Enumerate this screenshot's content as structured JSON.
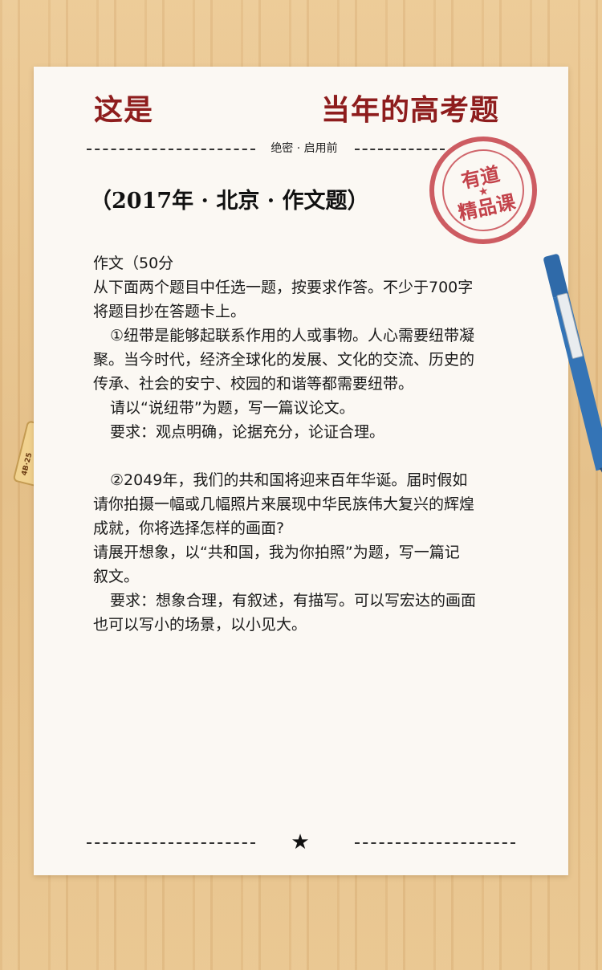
{
  "header": {
    "title_left": "这是",
    "title_right": "当年的高考题",
    "secret_label": "绝密 · 启用前"
  },
  "stamp": {
    "top_text": "有道",
    "star": "★",
    "bottom_text": "精品课"
  },
  "eraser": {
    "label": "4B·25"
  },
  "exam": {
    "subtitle": "（2017年 · 北京 · 作文题）",
    "lines": [
      "作文（50分",
      "从下面两个题目中任选一题，按要求作答。不少于700字",
      "将题目抄在答题卡上。",
      "①纽带是能够起联系作用的人或事物。人心需要纽带凝",
      "聚。当今时代，经济全球化的发展、文化的交流、历史的",
      "传承、社会的安宁、校园的和谐等都需要纽带。",
      "请以“说纽带”为题，写一篇议论文。",
      "要求：观点明确，论据充分，论证合理。",
      "②2049年，我们的共和国将迎来百年华诞。届时假如",
      "请你拍摄一幅或几幅照片来展现中华民族伟大复兴的辉煌",
      "成就，你将选择怎样的画面?",
      "请展开想象，以“共和国，我为你拍照”为题，写一篇记",
      "叙文。",
      "要求：想象合理，有叙述，有描写。可以写宏达的画面",
      "也可以写小的场景，以小见大。"
    ]
  },
  "footer": {
    "star": "★"
  },
  "colors": {
    "title": "#8e1d1d",
    "stamp": "#b9232d",
    "pen": "#3474b6",
    "paper": "#fbf8f3",
    "background": "#e7c48f"
  }
}
